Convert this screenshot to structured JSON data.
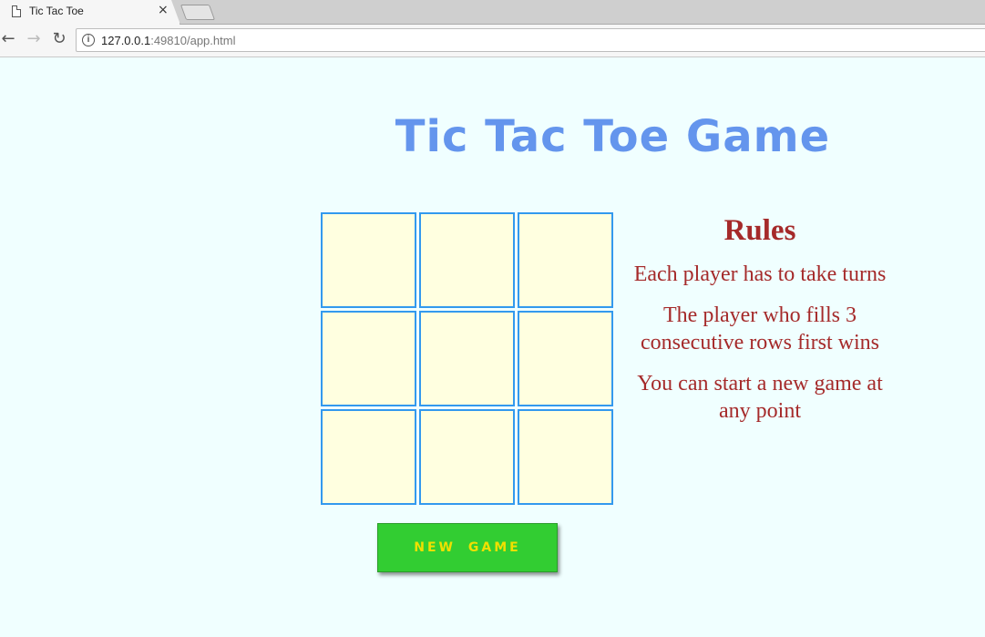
{
  "browser": {
    "tab_title": "Tic Tac Toe",
    "tab_close": "×",
    "url_host": "127.0.0.1",
    "url_rest": ":49810/app.html",
    "back_icon": "←",
    "forward_icon": "→",
    "reload_icon": "↻",
    "info_icon": "i"
  },
  "page": {
    "title": "Tic Tac Toe Game",
    "title_color": "#6495ed",
    "background_color": "#f0ffff"
  },
  "board": {
    "cells": [
      "",
      "",
      "",
      "",
      "",
      "",
      "",
      "",
      ""
    ],
    "cell_color": "#ffffe0",
    "border_color": "#3399ee"
  },
  "rules": {
    "heading": "Rules",
    "items": [
      "Each player has to take turns",
      "The player who fills 3 consecutive rows first wins",
      "You can start a new game at any point"
    ],
    "color": "#a52a2a"
  },
  "new_game_button": {
    "label": "NEW GAME",
    "background": "#32cd32",
    "text_color": "#f0e000"
  }
}
